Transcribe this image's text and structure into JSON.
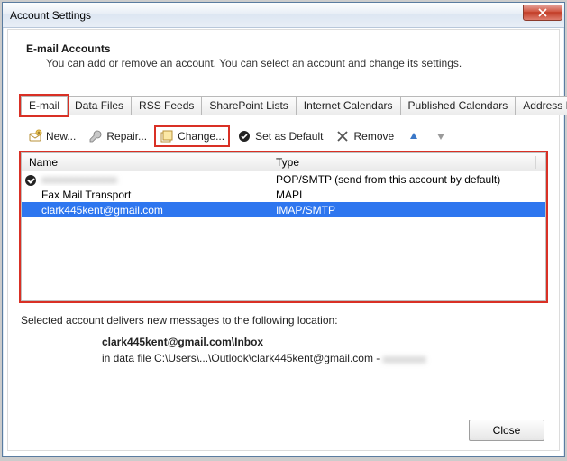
{
  "window": {
    "title": "Account Settings"
  },
  "header": {
    "title": "E-mail Accounts",
    "sub": "You can add or remove an account. You can select an account and change its settings."
  },
  "tabs": [
    "E-mail",
    "Data Files",
    "RSS Feeds",
    "SharePoint Lists",
    "Internet Calendars",
    "Published Calendars",
    "Address Books"
  ],
  "toolbar": {
    "new": "New...",
    "repair": "Repair...",
    "change": "Change...",
    "default": "Set as Default",
    "remove": "Remove"
  },
  "columns": {
    "name": "Name",
    "type": "Type"
  },
  "rows": [
    {
      "name": "xxxxxxxxxxxxxx",
      "type": "POP/SMTP (send from this account by default)",
      "default": true,
      "blurred": true
    },
    {
      "name": "Fax Mail Transport",
      "type": "MAPI"
    },
    {
      "name": "clark445kent@gmail.com",
      "type": "IMAP/SMTP",
      "selected": true
    }
  ],
  "location": {
    "intro": "Selected account delivers new messages to the following location:",
    "path": "clark445kent@gmail.com\\Inbox",
    "file_prefix": "in data file C:\\Users\\...\\Outlook\\clark445kent@gmail.com - ",
    "blurred_tail": "xxxxxxxx"
  },
  "footer": {
    "close": "Close"
  }
}
